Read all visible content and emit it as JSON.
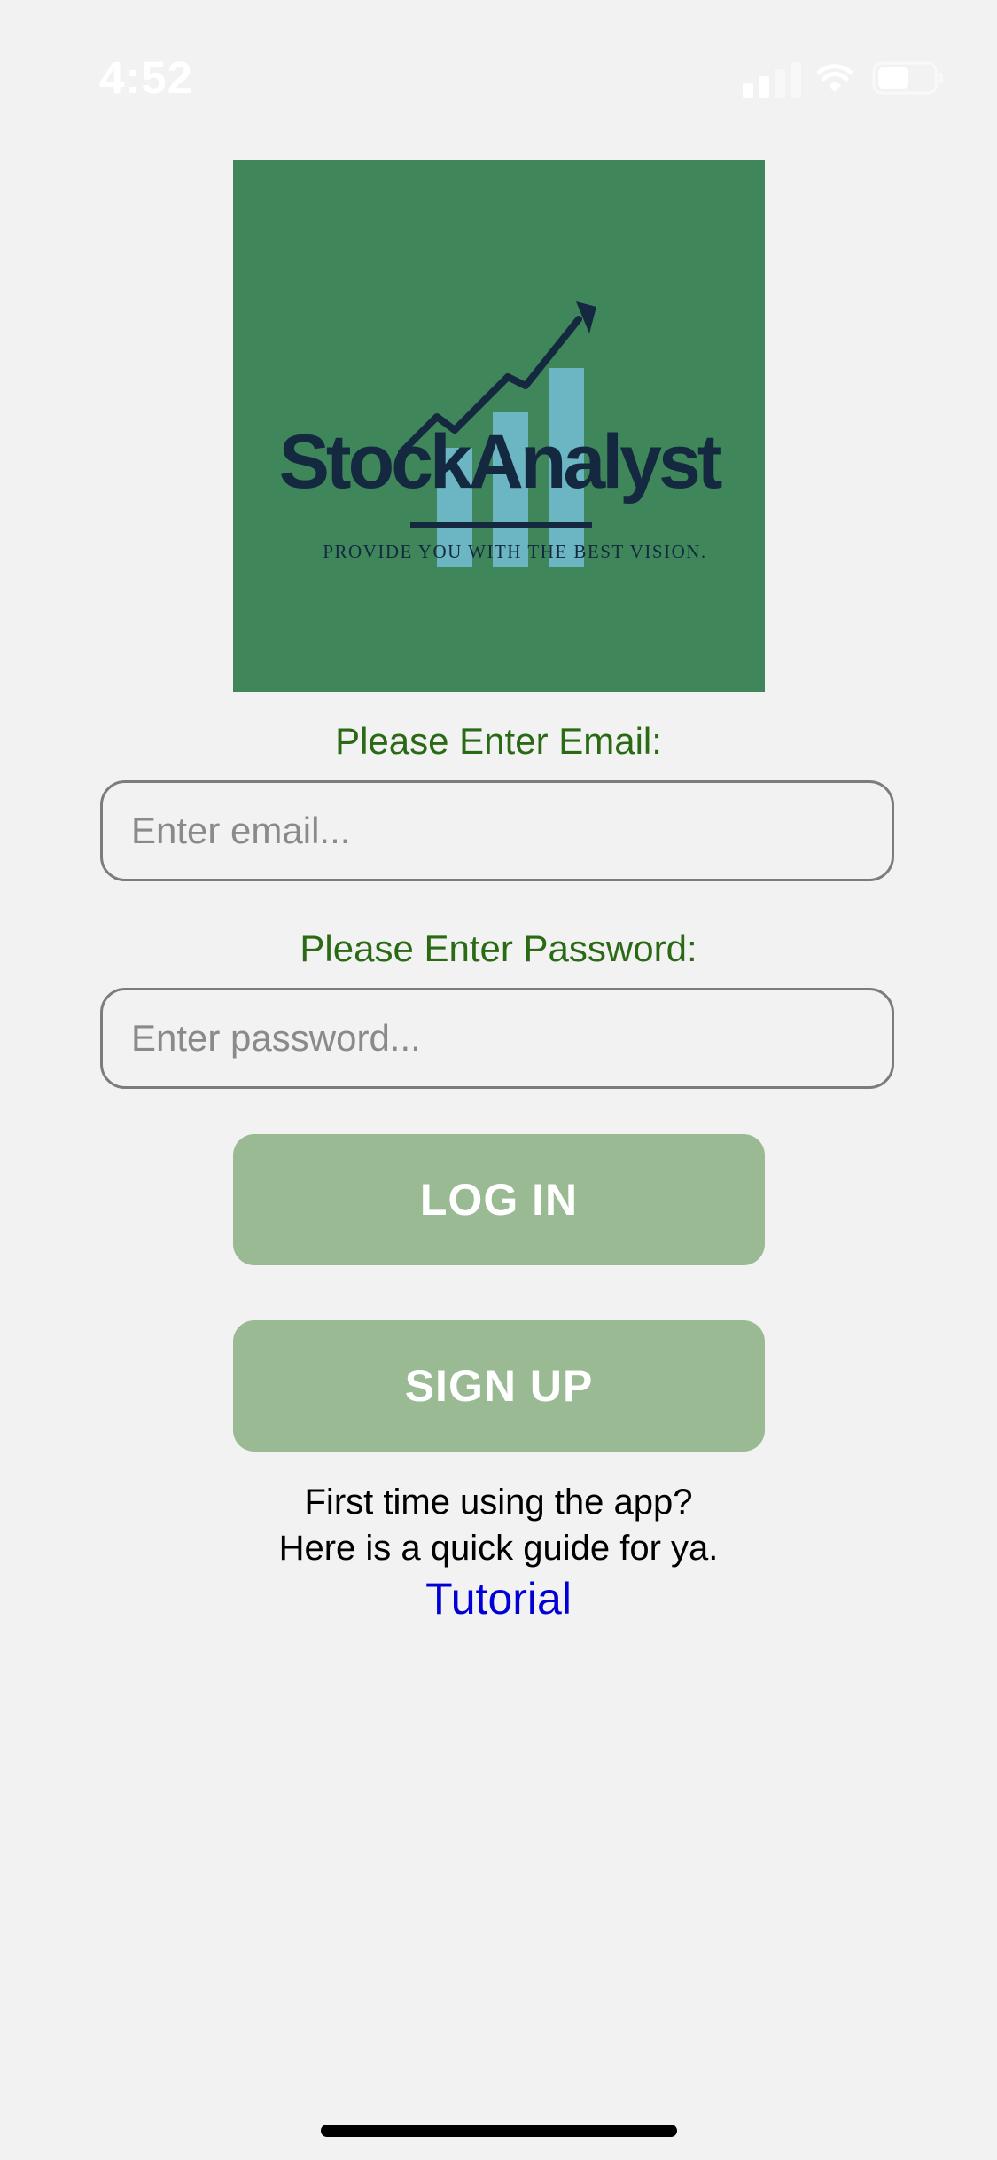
{
  "status_bar": {
    "time": "4:52",
    "signal_icon": "cellular-signal-icon",
    "wifi_icon": "wifi-icon",
    "battery_icon": "battery-icon"
  },
  "logo": {
    "brand": "StockAnalyst",
    "tagline": "PROVIDE YOU WITH THE BEST VISION.",
    "background_color": "#3f875a"
  },
  "form": {
    "email_label": "Please Enter Email:",
    "email_placeholder": "Enter email...",
    "email_value": "",
    "password_label": "Please Enter Password:",
    "password_placeholder": "Enter password...",
    "password_value": "",
    "login_label": "LOG IN",
    "signup_label": "SIGN UP",
    "label_color": "#2a6a14",
    "button_color": "#9aba93"
  },
  "guide": {
    "line1": "First time using the app?",
    "line2": "Here is a quick guide for ya.",
    "tutorial_label": "Tutorial",
    "link_color": "#0000d6"
  }
}
